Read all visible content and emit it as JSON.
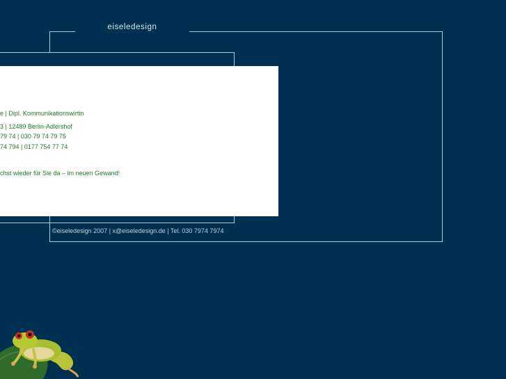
{
  "brand": {
    "name": "eiseledesign"
  },
  "content": {
    "lines": [
      "e | Dipl. Kommunikationswirtin",
      "3 | 12489 Berlin-Adlershof",
      "79 74 | 030 79 74 79 75",
      "74 794 | 0177 754 77 74",
      "chst wieder für Sie da – im neuen Gewand!"
    ]
  },
  "footer": {
    "text": "©eiseledesign 2007 | x@eiseledesign.de | Tel. 030 7974 7974"
  },
  "colors": {
    "background": "#00304f",
    "frame_line": "#a8cfe0",
    "content_text": "#1f7a2a",
    "footer_text": "#b9d3df"
  },
  "decor": {
    "image": "tree-frog-on-leaf"
  }
}
